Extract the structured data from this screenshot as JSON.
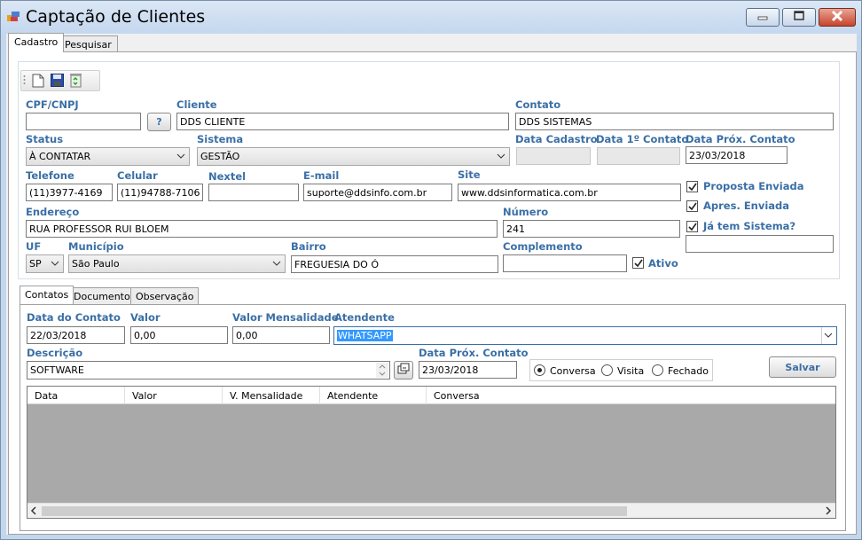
{
  "window": {
    "title": "Captação de Clientes"
  },
  "tabs": {
    "cadastro": "Cadastro",
    "pesquisar": "Pesquisar"
  },
  "form": {
    "cpf_label": "CPF/CNPJ",
    "cpf_value": "",
    "cpf_search_button": "?",
    "cliente_label": "Cliente",
    "cliente_value": "DDS CLIENTE",
    "contato_label": "Contato",
    "contato_value": "DDS SISTEMAS",
    "status_label": "Status",
    "status_value": "À CONTATAR",
    "sistema_label": "Sistema",
    "sistema_value": "GESTÃO",
    "data_cadastro_label": "Data Cadastro",
    "data_cadastro_value": "",
    "data_1_contato_label": "Data 1º Contato",
    "data_1_contato_value": "",
    "data_prox_contato_label": "Data Próx. Contato",
    "data_prox_contato_value": "23/03/2018",
    "telefone_label": "Telefone",
    "telefone_value": "(11)3977-4169",
    "celular_label": "Celular",
    "celular_value": "(11)94788-7106",
    "nextel_label": "Nextel",
    "nextel_value": "",
    "email_label": "E-mail",
    "email_value": "suporte@ddsinfo.com.br",
    "site_label": "Site",
    "site_value": "www.ddsinformatica.com.br",
    "endereco_label": "Endereço",
    "endereco_value": "RUA PROFESSOR RUI BLOEM",
    "numero_label": "Número",
    "numero_value": "241",
    "uf_label": "UF",
    "uf_value": "SP",
    "municipio_label": "Município",
    "municipio_value": "São Paulo",
    "bairro_label": "Bairro",
    "bairro_value": "FREGUESIA DO Ó",
    "complemento_label": "Complemento",
    "complemento_value": "",
    "ativo_label": "Ativo",
    "proposta_label": "Proposta Enviada",
    "apres_label": "Apres. Enviada",
    "ja_tem_label": "Já tem Sistema?",
    "ja_tem_value": ""
  },
  "inner_tabs": {
    "contatos": "Contatos",
    "documentos": "Documentos",
    "observacao": "Observação"
  },
  "contato_form": {
    "data_label": "Data do Contato",
    "data_value": "22/03/2018",
    "valor_label": "Valor",
    "valor_value": "0,00",
    "valor_mensal_label": "Valor Mensalidade",
    "valor_mensal_value": "0,00",
    "atendente_label": "Atendente",
    "atendente_value": "WHATSAPP",
    "descricao_label": "Descrição",
    "descricao_value": "SOFTWARE",
    "prox_label": "Data Próx. Contato",
    "prox_value": "23/03/2018",
    "radio_conversa": "Conversa",
    "radio_visita": "Visita",
    "radio_fechado": "Fechado",
    "salvar_label": "Salvar"
  },
  "grid": {
    "columns": [
      "Data",
      "Valor",
      "V. Mensalidade",
      "Atendente",
      "Conversa"
    ]
  },
  "colors": {
    "label_blue": "#3a6fa6",
    "selection_blue": "#3399ff"
  }
}
